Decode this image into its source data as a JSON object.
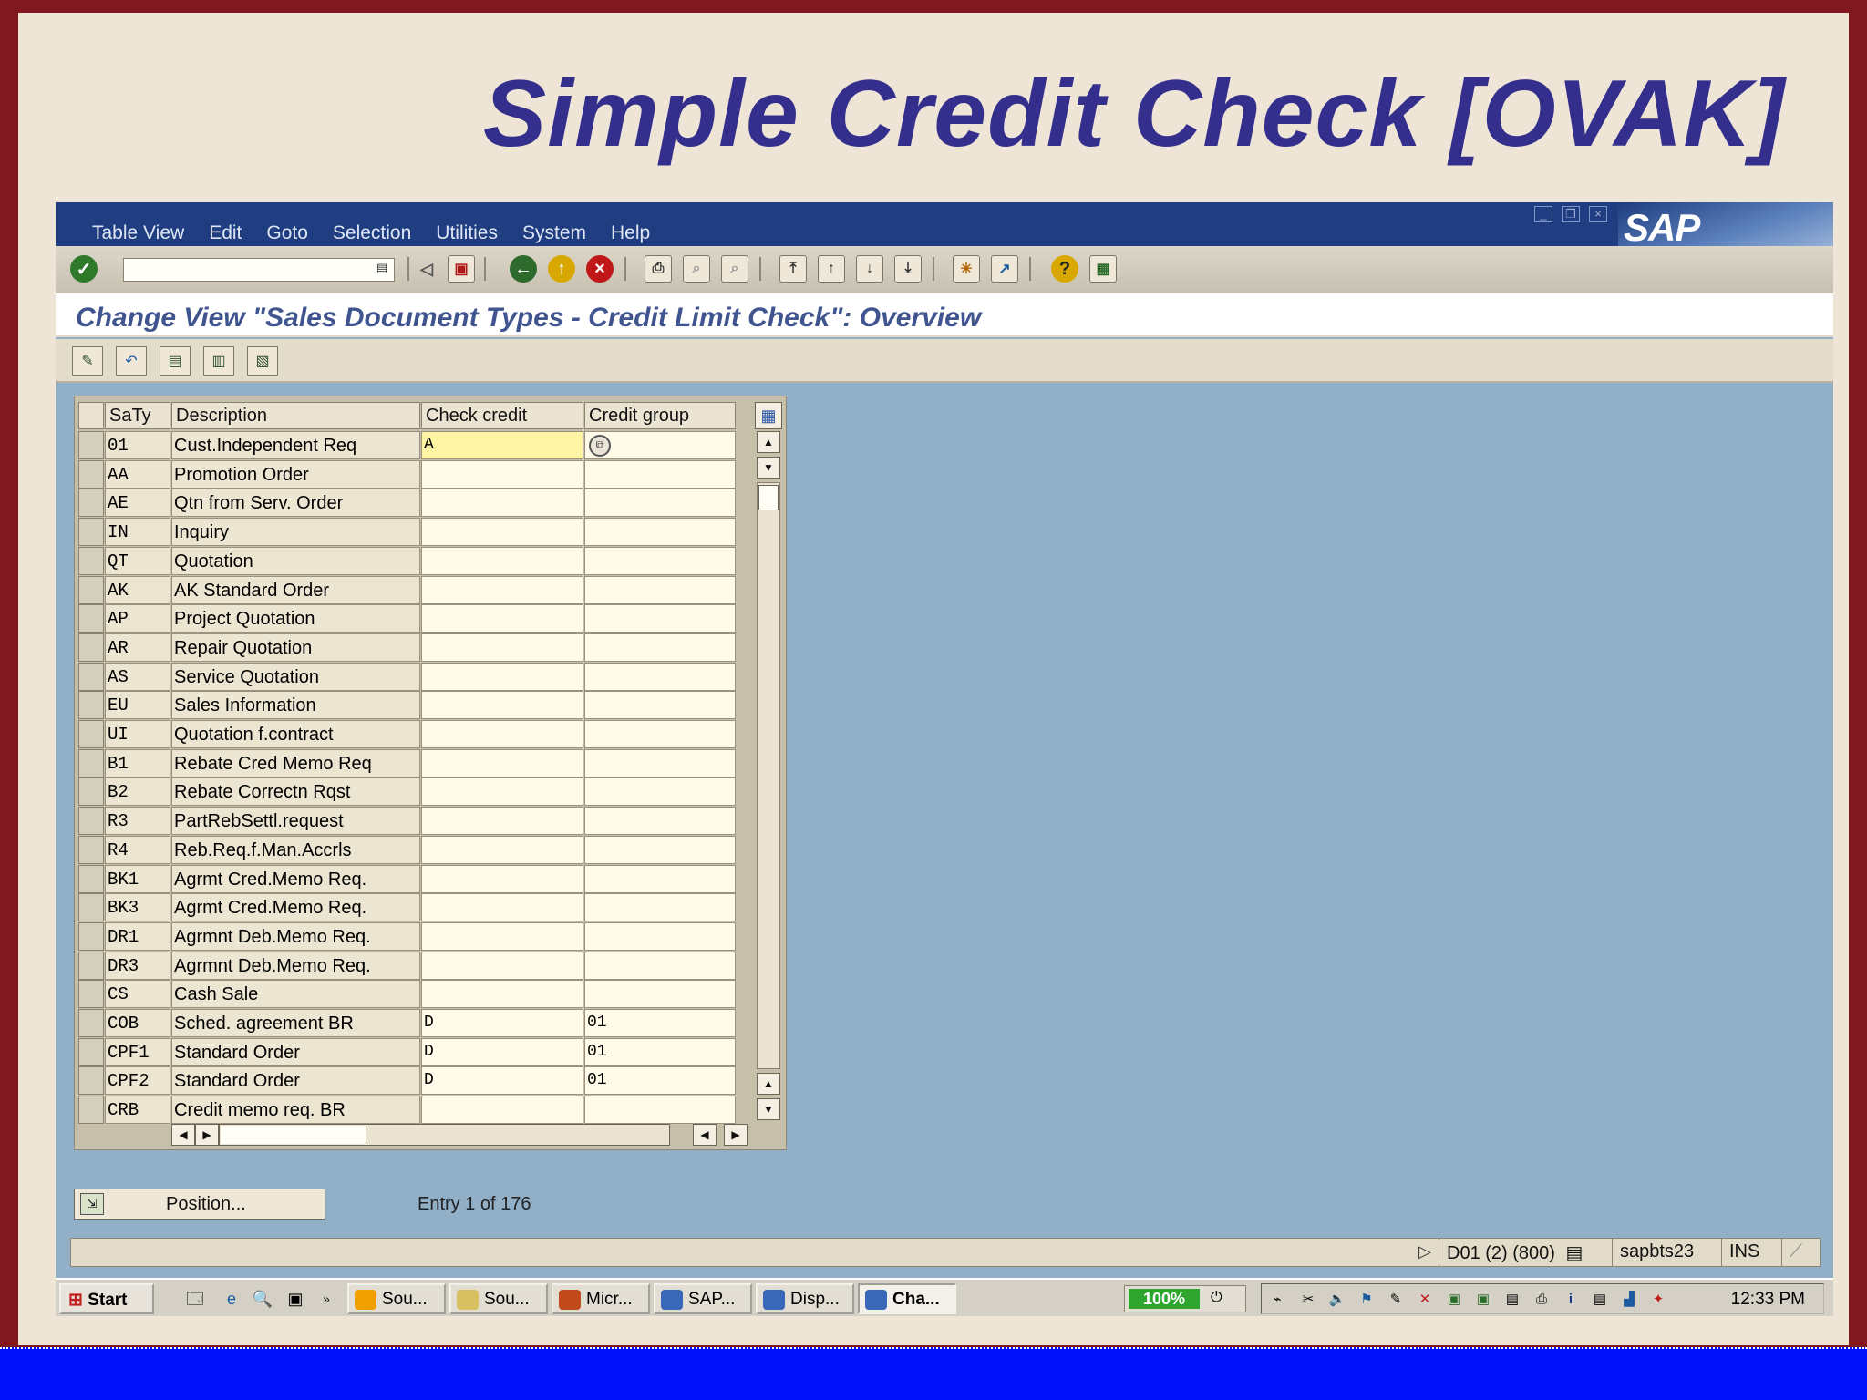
{
  "slide": {
    "title": "Simple Credit Check [OVAK]"
  },
  "menu": [
    "Table View",
    "Edit",
    "Goto",
    "Selection",
    "Utilities",
    "System",
    "Help"
  ],
  "logo": "SAP",
  "screen_title": "Change View \"Sales Document Types - Credit Limit Check\": Overview",
  "table": {
    "headers": {
      "key": "SaTy",
      "description": "Description",
      "check_credit": "Check credit",
      "credit_group": "Credit group"
    },
    "rows": [
      {
        "key": "01",
        "description": "Cust.Independent Req",
        "check": "A",
        "group": ""
      },
      {
        "key": "AA",
        "description": "Promotion Order",
        "check": "",
        "group": ""
      },
      {
        "key": "AE",
        "description": "Qtn from Serv. Order",
        "check": "",
        "group": ""
      },
      {
        "key": "IN",
        "description": "Inquiry",
        "check": "",
        "group": ""
      },
      {
        "key": "QT",
        "description": "Quotation",
        "check": "",
        "group": ""
      },
      {
        "key": "AK",
        "description": "AK Standard Order",
        "check": "",
        "group": ""
      },
      {
        "key": "AP",
        "description": "Project Quotation",
        "check": "",
        "group": ""
      },
      {
        "key": "AR",
        "description": "Repair Quotation",
        "check": "",
        "group": ""
      },
      {
        "key": "AS",
        "description": "Service Quotation",
        "check": "",
        "group": ""
      },
      {
        "key": "EU",
        "description": "Sales Information",
        "check": "",
        "group": ""
      },
      {
        "key": "UI",
        "description": "Quotation f.contract",
        "check": "",
        "group": ""
      },
      {
        "key": "B1",
        "description": "Rebate Cred Memo Req",
        "check": "",
        "group": ""
      },
      {
        "key": "B2",
        "description": "Rebate Correctn Rqst",
        "check": "",
        "group": ""
      },
      {
        "key": "R3",
        "description": "PartRebSettl.request",
        "check": "",
        "group": ""
      },
      {
        "key": "R4",
        "description": "Reb.Req.f.Man.Accrls",
        "check": "",
        "group": ""
      },
      {
        "key": "BK1",
        "description": "Agrmt Cred.Memo Req.",
        "check": "",
        "group": ""
      },
      {
        "key": "BK3",
        "description": "Agrmt Cred.Memo Req.",
        "check": "",
        "group": ""
      },
      {
        "key": "DR1",
        "description": "Agrmnt Deb.Memo Req.",
        "check": "",
        "group": ""
      },
      {
        "key": "DR3",
        "description": "Agrmnt Deb.Memo Req.",
        "check": "",
        "group": ""
      },
      {
        "key": "CS",
        "description": "Cash Sale",
        "check": "",
        "group": ""
      },
      {
        "key": "COB",
        "description": "Sched. agreement BR",
        "check": "D",
        "group": "01"
      },
      {
        "key": "CPF1",
        "description": "Standard Order",
        "check": "D",
        "group": "01"
      },
      {
        "key": "CPF2",
        "description": "Standard Order",
        "check": "D",
        "group": "01"
      },
      {
        "key": "CRB",
        "description": "Credit memo req. BR",
        "check": "",
        "group": ""
      }
    ]
  },
  "position_button": "Position...",
  "entry_text": "Entry 1 of 176",
  "statusbar": {
    "system": "D01 (2) (800)",
    "server": "sapbts23",
    "mode": "INS"
  },
  "taskbar": {
    "start": "Start",
    "tasks": [
      "Sou...",
      "Sou...",
      "Micr...",
      "SAP...",
      "Disp...",
      "Cha..."
    ],
    "zoom": "100%",
    "clock": "12:33 PM"
  },
  "colors": {
    "frame": "#801820",
    "slide_bg": "#efe5d6",
    "title": "#342f8d",
    "sap_blue": "#1f3d80",
    "screen_bg": "#92afc8",
    "bottom_band": "#0010f8"
  }
}
